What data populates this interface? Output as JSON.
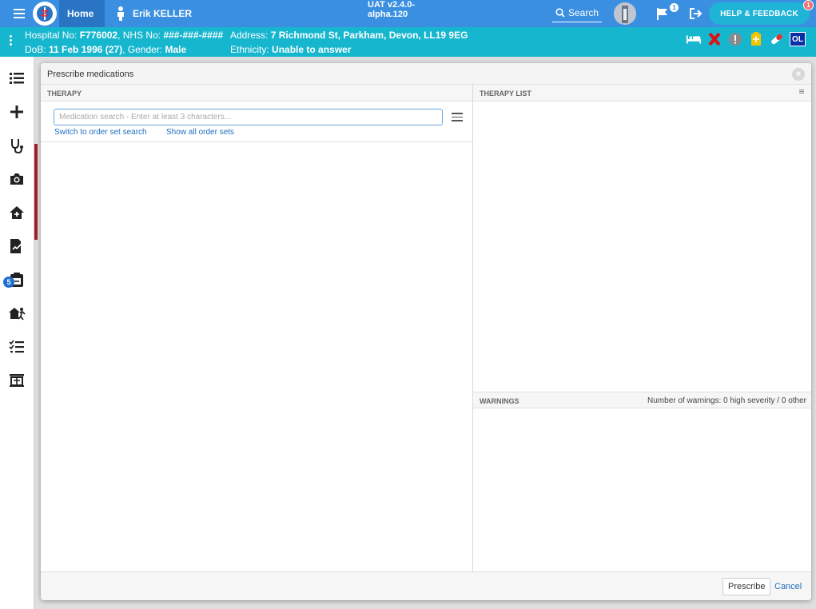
{
  "app": {
    "version": "UAT v2.4.0-alpha.120",
    "breadcrumb_home": "Home",
    "current_user": "Erik KELLER",
    "search_label": "Search",
    "flag_count": "1",
    "help_label": "HELP & FEEDBACK",
    "help_count": "1",
    "accent_color": "#3a8fe0",
    "banner_color": "#17b6cf"
  },
  "patient": {
    "line1_hospital_label": "Hospital No:",
    "line1_hospital_value": "F776002",
    "line1_nhs_label": "NHS No:",
    "line1_nhs_value": "###-###-####",
    "line2_dob_label": "DoB:",
    "line2_dob_value": "11 Feb 1996 (27)",
    "line2_gender_label": "Gender:",
    "line2_gender_value": "Male",
    "address_label": "Address:",
    "address_value": "7 Richmond St, Parkham, Devon, LL19 9EG",
    "ethnicity_label": "Ethnicity:",
    "ethnicity_value": "Unable to answer",
    "ol_badge": "OL"
  },
  "sidebar": {
    "badge_count": "5",
    "items": [
      "list-icon",
      "plus-icon",
      "stethoscope-icon",
      "camera-icon",
      "home-plus-icon",
      "document-sign-icon",
      "clipboard-icon",
      "home-run-icon",
      "checklist-icon",
      "bed-table-icon"
    ]
  },
  "modal": {
    "title": "Prescribe medications",
    "therapy_header": "THERAPY",
    "therapy_list_header": "THERAPY LIST",
    "warnings_header": "WARNINGS",
    "warnings_count": "Number of warnings: 0 high severity / 0 other",
    "search_placeholder": "Medication search - Enter at least 3 characters...",
    "search_value": "",
    "switch_link": "Switch to order set search",
    "show_all_link": "Show all order sets",
    "prescribe_label": "Prescribe",
    "cancel_label": "Cancel"
  }
}
